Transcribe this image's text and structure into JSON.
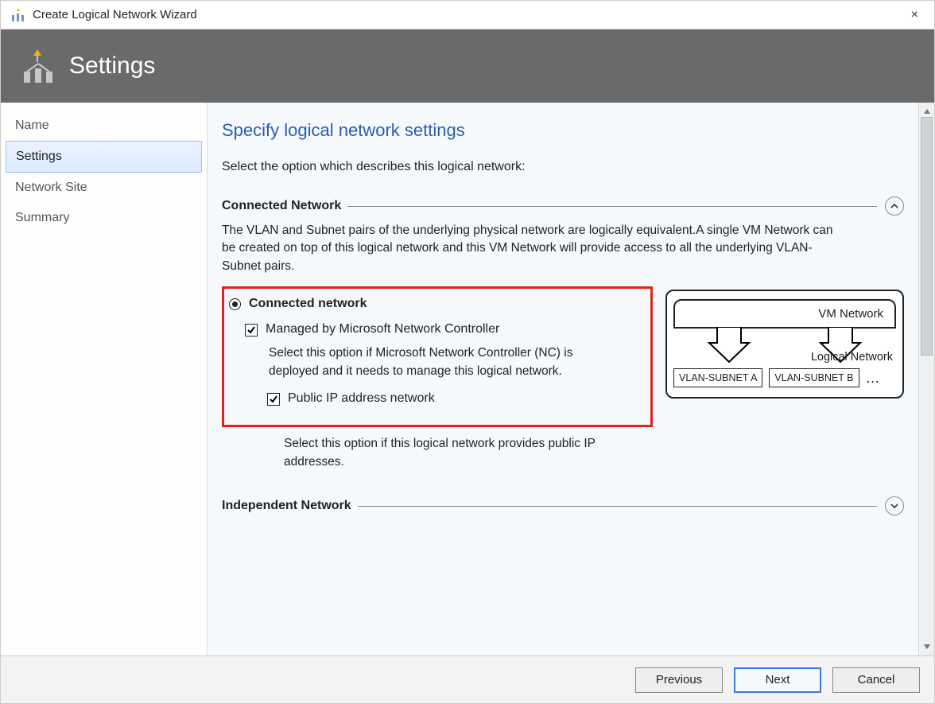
{
  "window": {
    "title": "Create Logical Network Wizard",
    "close": "×"
  },
  "header": {
    "title": "Settings"
  },
  "sidebar": {
    "items": [
      {
        "label": "Name",
        "active": false
      },
      {
        "label": "Settings",
        "active": true
      },
      {
        "label": "Network Site",
        "active": false
      },
      {
        "label": "Summary",
        "active": false
      }
    ]
  },
  "content": {
    "heading": "Specify logical network settings",
    "instruction": "Select the option which describes this logical network:",
    "section_connected": {
      "title": "Connected Network",
      "desc": "The VLAN and Subnet pairs of the underlying physical network are logically equivalent.A single VM Network can be created on top of this logical network and this VM Network will provide access to all the underlying VLAN-Subnet pairs.",
      "radio_label": "Connected network",
      "checkbox_managed": "Managed by Microsoft Network Controller",
      "managed_desc": "Select this option if Microsoft Network Controller (NC) is deployed and it needs to manage this logical network.",
      "checkbox_public": "Public IP address network",
      "public_desc": "Select this option if this logical network provides public IP addresses."
    },
    "section_independent": {
      "title": "Independent Network"
    },
    "diagram": {
      "vm_label": "VM Network",
      "ln_label": "Logical  Network",
      "vlan_a": "VLAN-SUBNET A",
      "vlan_b": "VLAN-SUBNET B",
      "dots": "…"
    }
  },
  "footer": {
    "previous": "Previous",
    "next": "Next",
    "cancel": "Cancel"
  }
}
